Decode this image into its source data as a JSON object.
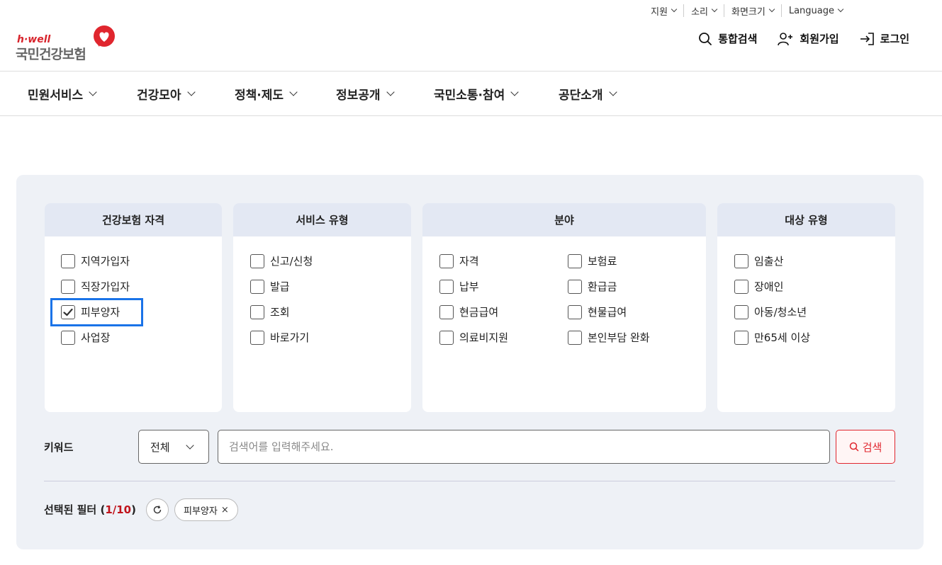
{
  "util_menu": [
    {
      "label": "지원"
    },
    {
      "label": "소리"
    },
    {
      "label": "화면크기"
    },
    {
      "label": "Language"
    }
  ],
  "logo": {
    "brand": "h·well",
    "name": "국민건강보험"
  },
  "user_nav": {
    "search": "통합검색",
    "signup": "회원가입",
    "login": "로그인"
  },
  "gnb": [
    {
      "label": "민원서비스"
    },
    {
      "label": "건강모아"
    },
    {
      "label": "정책·제도"
    },
    {
      "label": "정보공개"
    },
    {
      "label": "국민소통·참여"
    },
    {
      "label": "공단소개"
    }
  ],
  "filters": {
    "qualification": {
      "title": "건강보험 자격",
      "options": [
        {
          "label": "지역가입자",
          "checked": false
        },
        {
          "label": "직장가입자",
          "checked": false
        },
        {
          "label": "피부양자",
          "checked": true
        },
        {
          "label": "사업장",
          "checked": false
        }
      ]
    },
    "service_type": {
      "title": "서비스 유형",
      "options": [
        {
          "label": "신고/신청",
          "checked": false
        },
        {
          "label": "발급",
          "checked": false
        },
        {
          "label": "조회",
          "checked": false
        },
        {
          "label": "바로가기",
          "checked": false
        }
      ]
    },
    "field": {
      "title": "분야",
      "options": [
        {
          "label": "자격",
          "checked": false
        },
        {
          "label": "보험료",
          "checked": false
        },
        {
          "label": "납부",
          "checked": false
        },
        {
          "label": "환급금",
          "checked": false
        },
        {
          "label": "현금급여",
          "checked": false
        },
        {
          "label": "현물급여",
          "checked": false
        },
        {
          "label": "의료비지원",
          "checked": false
        },
        {
          "label": "본인부담 완화",
          "checked": false
        }
      ]
    },
    "target": {
      "title": "대상 유형",
      "options": [
        {
          "label": "임출산",
          "checked": false
        },
        {
          "label": "장애인",
          "checked": false
        },
        {
          "label": "아동/청소년",
          "checked": false
        },
        {
          "label": "만65세 이상",
          "checked": false
        }
      ]
    }
  },
  "keyword": {
    "label": "키워드",
    "scope": "전체",
    "placeholder": "검색어를 입력해주세요.",
    "value": "",
    "search_label": "검색"
  },
  "selected": {
    "label_prefix": "선택된 필터 (",
    "count": "1/10",
    "label_suffix": ")",
    "chips": [
      {
        "label": "피부양자"
      }
    ]
  },
  "colors": {
    "accent": "#e0262e",
    "highlight": "#1a73e8",
    "panel": "#eef1f6",
    "card_header": "#e3e8f3"
  }
}
